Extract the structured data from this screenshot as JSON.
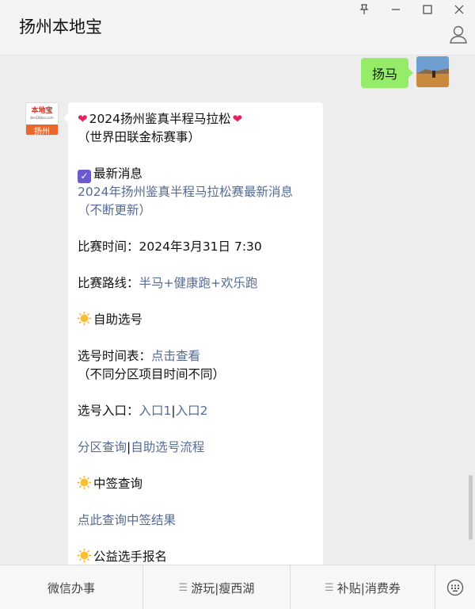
{
  "window": {
    "title": "扬州本地宝",
    "controls": [
      "pin-icon",
      "minimize-icon",
      "maximize-icon",
      "close-icon"
    ]
  },
  "chat": {
    "me": {
      "message": "扬马"
    },
    "bot": {
      "avatar": {
        "brand": "本地宝",
        "site": "BenDiBao.com",
        "city": "扬州"
      },
      "lines": {
        "headline": "2024扬州鉴真半程马拉松",
        "headline_sub": "（世界田联金标赛事）",
        "news_title": "最新消息",
        "news_link_1": "2024年扬州鉴真半程马拉松赛最新消息",
        "news_link_2": "（不断更新）",
        "time_label": "比赛时间：",
        "time_value": "2024年3月31日 7:30",
        "route_label": "比赛路线：",
        "route_link": "半马+健康跑+欢乐跑",
        "self_select_title": "自助选号",
        "schedule_label": "选号时间表：",
        "schedule_link": "点击查看",
        "schedule_note": "（不同分区项目时间不同）",
        "entry_label": "选号入口：",
        "entry_1": "入口1",
        "entry_sep": "|",
        "entry_2": "入口2",
        "zone_link": "分区查询",
        "zone_sep": "|",
        "flow_link": "自助选号流程",
        "lottery_title": "中签查询",
        "lottery_link": "点此查询中签结果",
        "charity_title": "公益选手报名"
      }
    }
  },
  "menu": {
    "items": [
      {
        "label": "微信办事"
      },
      {
        "label": "游玩|瘦西湖"
      },
      {
        "label": "补贴|消费券"
      }
    ]
  },
  "colors": {
    "link": "#576b95",
    "bubble_me": "#95ec69",
    "accent": "#e9682a"
  }
}
